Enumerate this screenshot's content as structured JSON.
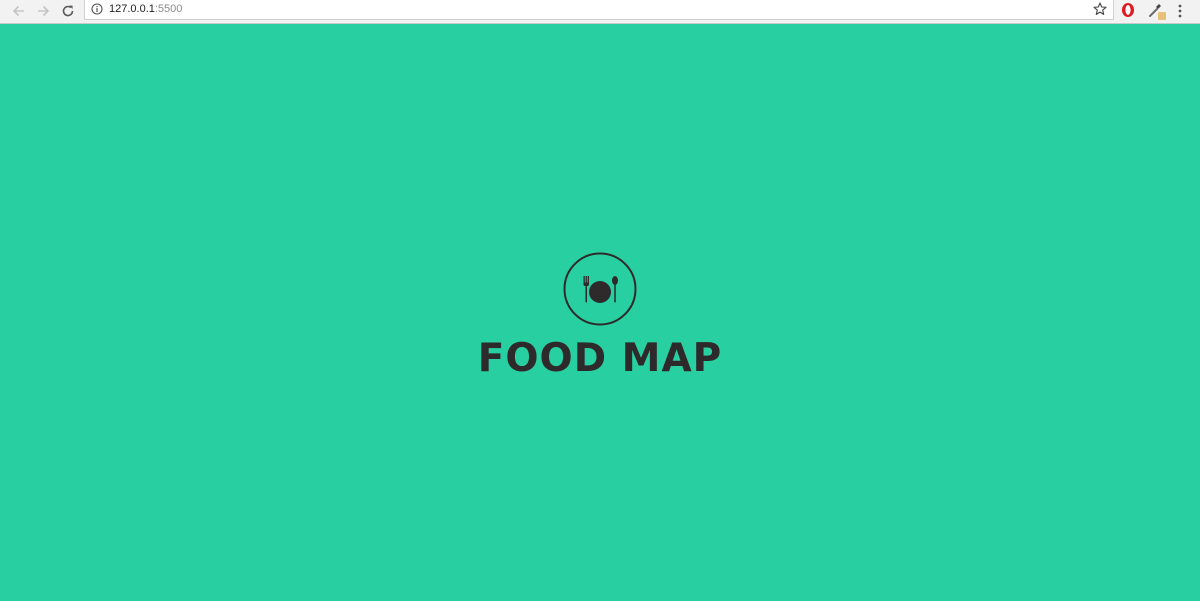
{
  "browser": {
    "url_host": "127.0.0.1",
    "url_port": ":5500",
    "icons": {
      "back": "arrow-left-icon",
      "forward": "arrow-right-icon",
      "reload": "reload-icon",
      "info": "info-icon",
      "bookmark": "star-icon",
      "extension_1": "opera-icon",
      "extension_2": "color-picker-icon",
      "menu": "kebab-menu-icon"
    }
  },
  "page": {
    "background_color": "#28cfa0",
    "brand": {
      "title": "FOOD MAP",
      "logo_icon": "plate-fork-spoon-icon",
      "color": "#2e2a2c"
    }
  }
}
